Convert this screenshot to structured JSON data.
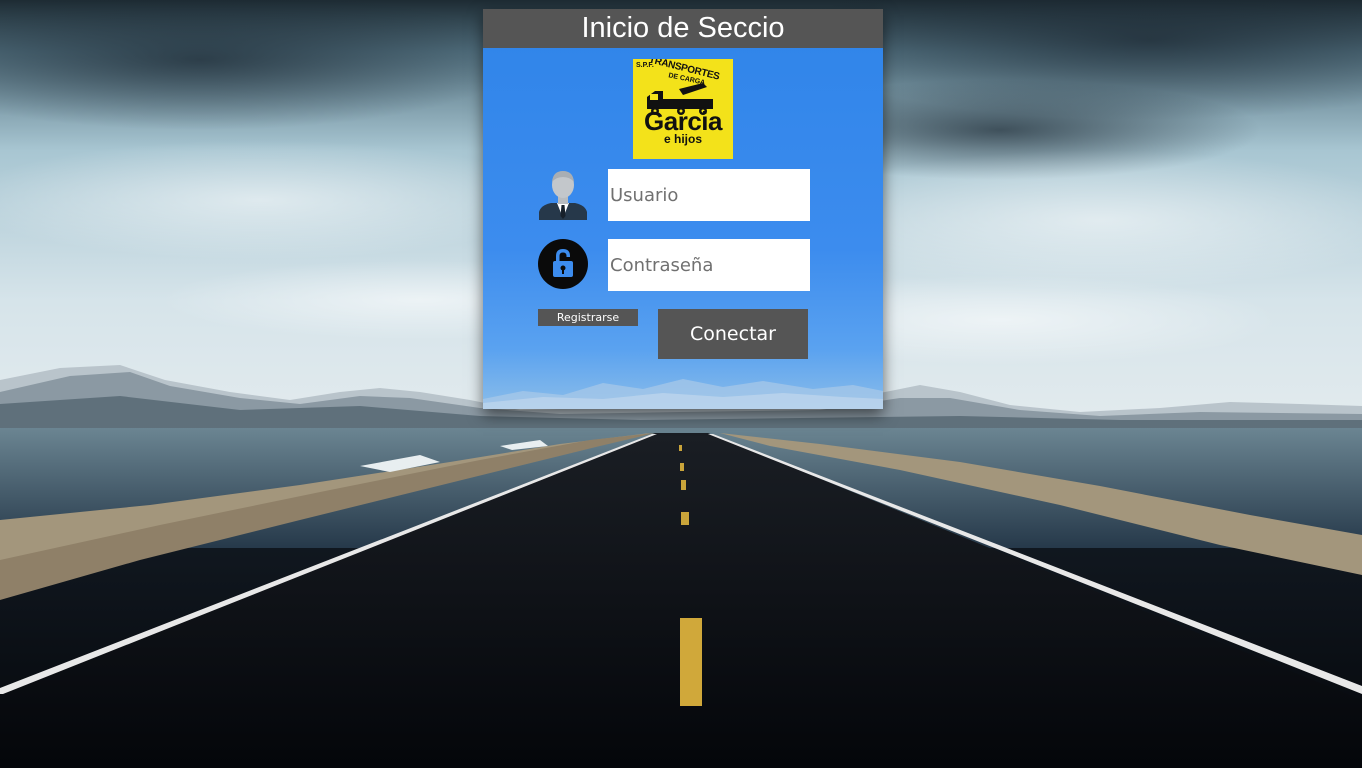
{
  "header": {
    "title": "Inicio de Seccio"
  },
  "logo": {
    "top_text": "S.P.F.",
    "arc_text": "TRANSPORTES",
    "arc_sub": "DE CARGA",
    "name": "Garcia",
    "subname": "e hijos",
    "background_color": "#f3e21a"
  },
  "form": {
    "username": {
      "icon": "user-icon",
      "placeholder": "Usuario",
      "value": ""
    },
    "password": {
      "icon": "lock-icon",
      "placeholder": "Contraseña",
      "value": ""
    },
    "register_label": "Registrarse",
    "connect_label": "Conectar"
  },
  "theme": {
    "panel_color": "#2f84e9",
    "header_color": "#555555",
    "button_color": "#555555"
  }
}
